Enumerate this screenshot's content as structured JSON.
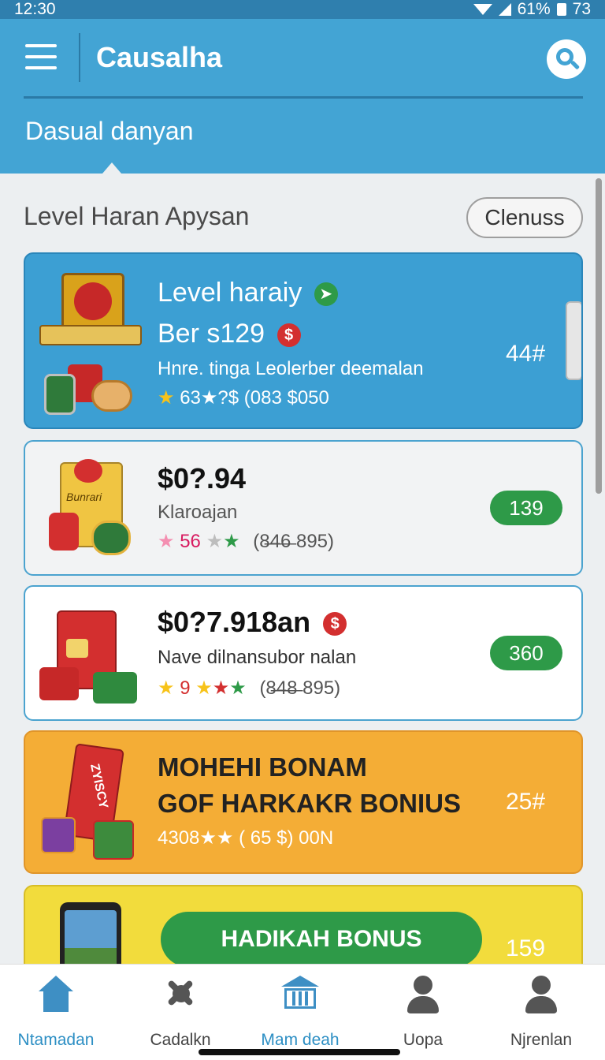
{
  "status_bar": {
    "time": "12:30",
    "battery": "61%",
    "signal_text": "73"
  },
  "header": {
    "title": "Causalha",
    "subtitle": "Dasual danyan"
  },
  "section": {
    "title": "Level Haran Apysan",
    "clear_label": "Clenuss"
  },
  "cards": [
    {
      "title": "Level haraiy",
      "price": "Ber s129",
      "price_badge": "$",
      "description": "Hnre. tinga Leolerber deemalan",
      "rating_text": "63★?$ (083 $050",
      "count": "44#"
    },
    {
      "price": "$0?.94",
      "name": "Klaroajan",
      "rating_text": "56",
      "meta": "(8̶4̶6̶ 895)",
      "count": "139",
      "box_label": "Bunrari"
    },
    {
      "price": "$0?7.918an",
      "price_badge": "$",
      "name": "Nave dilnansubor nalan",
      "rating_text": "9",
      "meta": "(8̶4̶8̶ 895)",
      "count": "360"
    },
    {
      "line1": "MOHEHI BONAM",
      "line2": "GOF HARKAKR BONIUS",
      "rating_text": "4308★★ ( 65 $) 00N",
      "count": "25#",
      "box_label": "ZYISCY"
    },
    {
      "button_label": "HADIKAH BONUS",
      "count": "159"
    }
  ],
  "nav": [
    {
      "label": "Ntamadan",
      "icon": "home-icon",
      "active": true
    },
    {
      "label": "Cadalkn",
      "icon": "tools-icon",
      "active": false
    },
    {
      "label": "Mam deah",
      "icon": "bank-icon",
      "active": true
    },
    {
      "label": "Uopa",
      "icon": "person-icon",
      "active": false
    },
    {
      "label": "Njrenlan",
      "icon": "profile-icon",
      "active": false
    }
  ],
  "colors": {
    "header": "#43a4d4",
    "accent_green": "#2e9a48",
    "card_orange": "#f4ad36",
    "card_yellow": "#f2dc3c",
    "active_nav": "#2d8fc4"
  }
}
